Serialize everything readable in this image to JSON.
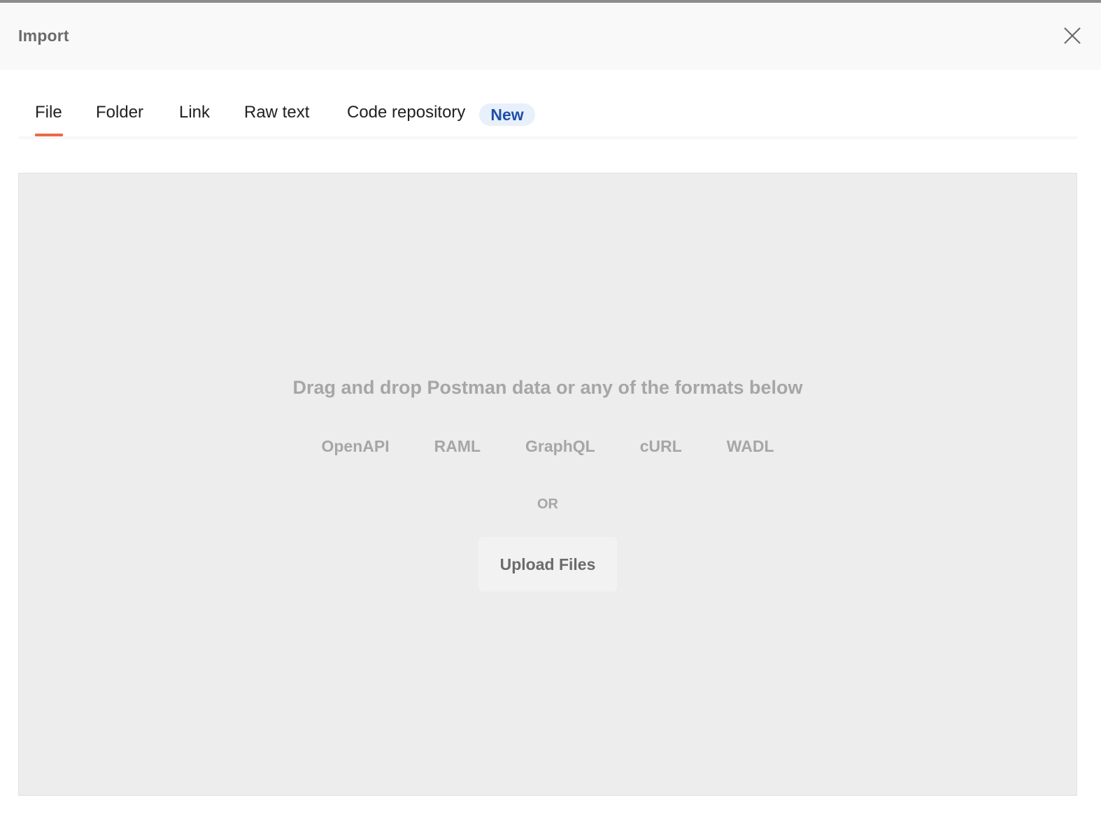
{
  "dialog": {
    "title": "Import",
    "close_icon": "close-icon"
  },
  "tabs": [
    {
      "label": "File",
      "active": true
    },
    {
      "label": "Folder",
      "active": false
    },
    {
      "label": "Link",
      "active": false
    },
    {
      "label": "Raw text",
      "active": false
    },
    {
      "label": "Code repository",
      "active": false,
      "badge": "New"
    }
  ],
  "colors": {
    "accent": "#eb6b42",
    "badge_bg": "#e8f0fb",
    "badge_text": "#1f4fa8"
  },
  "dropzone": {
    "title": "Drag and drop Postman data or any of the formats below",
    "formats": [
      "OpenAPI",
      "RAML",
      "GraphQL",
      "cURL",
      "WADL"
    ],
    "or_label": "OR",
    "upload_button": "Upload Files"
  }
}
